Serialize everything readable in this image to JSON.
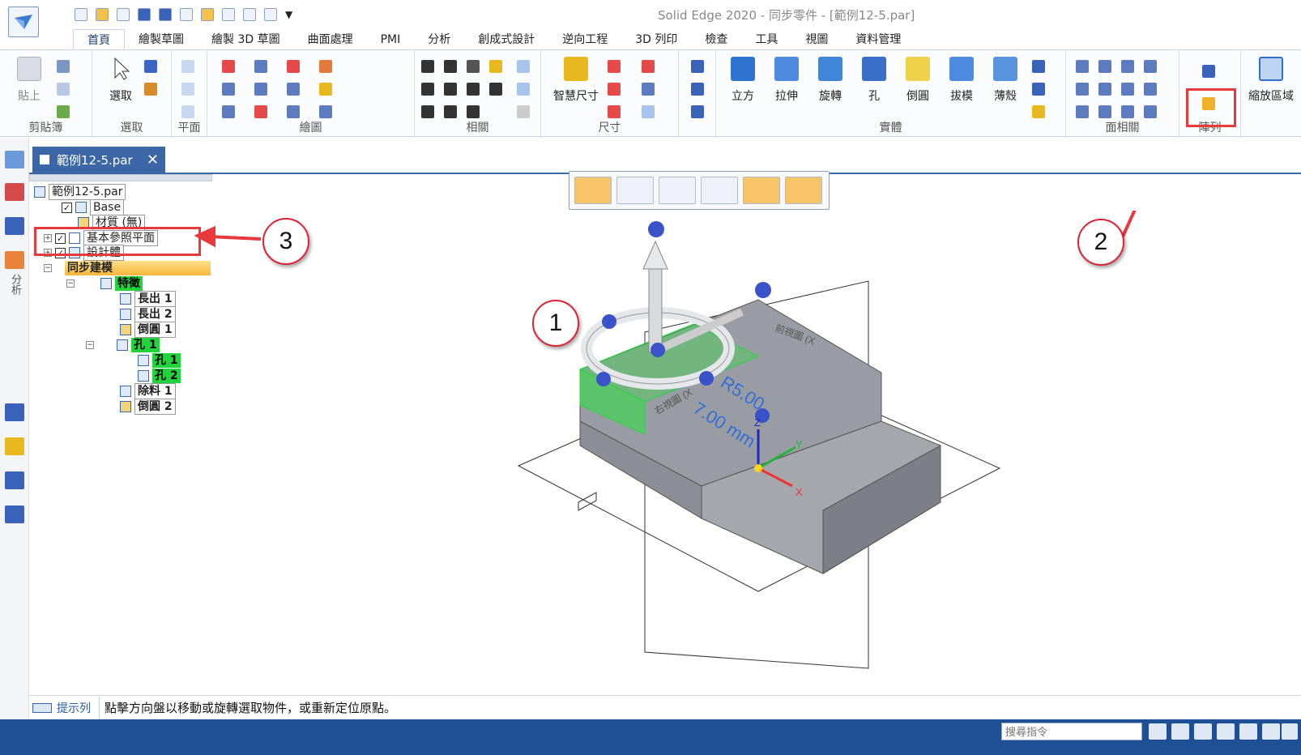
{
  "window": {
    "title": "Solid Edge 2020 - 同步零件 - [範例12-5.par]"
  },
  "tabs": [
    "首頁",
    "繪製草圖",
    "繪製 3D 草圖",
    "曲面處理",
    "PMI",
    "分析",
    "創成式設計",
    "逆向工程",
    "3D 列印",
    "檢查",
    "工具",
    "視圖",
    "資料管理"
  ],
  "ribbon": {
    "paste": "貼上",
    "clipboard": "剪貼簿",
    "select": "選取",
    "select_group": "選取",
    "plane_group": "平面",
    "draw_group": "繪圖",
    "relate_group": "相關",
    "smart_dim": "智慧尺寸",
    "dim_group": "尺寸",
    "solids": [
      "立方",
      "拉伸",
      "旋轉",
      "孔",
      "倒圓",
      "拔模",
      "薄殼"
    ],
    "solid_group": "實體",
    "face_rel_group": "面相關",
    "pattern_group": "陣列",
    "zoom_area": "縮放區域"
  },
  "document_tab": {
    "label": "範例12-5.par",
    "close": "✕"
  },
  "tree": {
    "root": "範例12-5.par",
    "base": "Base",
    "material": "材質 (無)",
    "ref_planes": "基本參照平面",
    "design_body": "設計體",
    "sync": "同步建模",
    "features": "特徵",
    "items": [
      "長出 1",
      "長出 2",
      "倒圓 1",
      "孔 1",
      "孔 1",
      "孔 2",
      "除料 1",
      "倒圓 2"
    ]
  },
  "left_toolbar": {
    "analysis": "分析"
  },
  "viewport": {
    "dim_radius": "R5.00",
    "dim_len": "7.00 mm",
    "axis_x": "X",
    "axis_y": "Y",
    "axis_z": "Z",
    "plane_text_1": "右視圖 (X",
    "plane_text_2": "前視圖 (X"
  },
  "callouts": [
    "1",
    "2",
    "3"
  ],
  "status": {
    "prompt_label": "提示列",
    "prompt_text": "點擊方向盤以移動或旋轉選取物件，或重新定位原點。"
  },
  "bottom": {
    "search_placeholder": "搜尋指令"
  },
  "colors": {
    "accent": "#3b67a6",
    "callout_red": "#e8393d",
    "feature_green": "#22d43b",
    "bottom_bar": "#1f4f94"
  }
}
